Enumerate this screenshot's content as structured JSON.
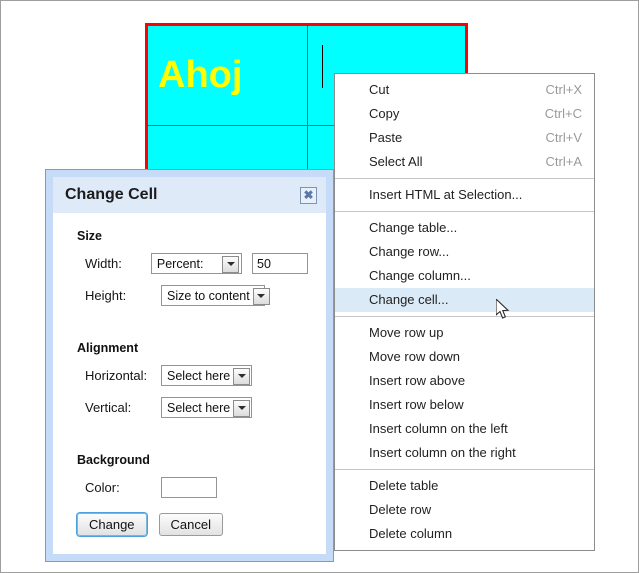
{
  "editor": {
    "table": {
      "cell_text": "Ahoj",
      "border_color": "#ff0000",
      "cell_background": "#00ffff",
      "text_color": "#ffff00",
      "rows": 3,
      "columns": 2
    }
  },
  "context_menu": {
    "groups": [
      {
        "items": [
          {
            "label": "Cut",
            "accel": "Ctrl+X",
            "highlighted": false
          },
          {
            "label": "Copy",
            "accel": "Ctrl+C",
            "highlighted": false
          },
          {
            "label": "Paste",
            "accel": "Ctrl+V",
            "highlighted": false
          },
          {
            "label": "Select All",
            "accel": "Ctrl+A",
            "highlighted": false
          }
        ]
      },
      {
        "items": [
          {
            "label": "Insert HTML at Selection...",
            "accel": "",
            "highlighted": false
          }
        ]
      },
      {
        "items": [
          {
            "label": "Change table...",
            "accel": "",
            "highlighted": false
          },
          {
            "label": "Change row...",
            "accel": "",
            "highlighted": false
          },
          {
            "label": "Change column...",
            "accel": "",
            "highlighted": false
          },
          {
            "label": "Change cell...",
            "accel": "",
            "highlighted": true
          }
        ]
      },
      {
        "items": [
          {
            "label": "Move row up",
            "accel": "",
            "highlighted": false
          },
          {
            "label": "Move row down",
            "accel": "",
            "highlighted": false
          },
          {
            "label": "Insert row above",
            "accel": "",
            "highlighted": false
          },
          {
            "label": "Insert row below",
            "accel": "",
            "highlighted": false
          },
          {
            "label": "Insert column on the left",
            "accel": "",
            "highlighted": false
          },
          {
            "label": "Insert column on the right",
            "accel": "",
            "highlighted": false
          }
        ]
      },
      {
        "items": [
          {
            "label": "Delete table",
            "accel": "",
            "highlighted": false
          },
          {
            "label": "Delete row",
            "accel": "",
            "highlighted": false
          },
          {
            "label": "Delete column",
            "accel": "",
            "highlighted": false
          }
        ]
      }
    ],
    "highlight_color": "#dbeaf7"
  },
  "dialog": {
    "title": "Change Cell",
    "close_glyph": "✖",
    "sections": {
      "size": {
        "title": "Size",
        "width_label": "Width:",
        "width_select_value": "Percent:",
        "width_value": "50",
        "height_label": "Height:",
        "height_select_value": "Size to content"
      },
      "alignment": {
        "title": "Alignment",
        "horizontal_label": "Horizontal:",
        "horizontal_select_value": "Select here",
        "vertical_label": "Vertical:",
        "vertical_select_value": "Select here"
      },
      "background": {
        "title": "Background",
        "color_label": "Color:",
        "color_value": ""
      }
    },
    "buttons": {
      "change": "Change",
      "cancel": "Cancel"
    }
  }
}
